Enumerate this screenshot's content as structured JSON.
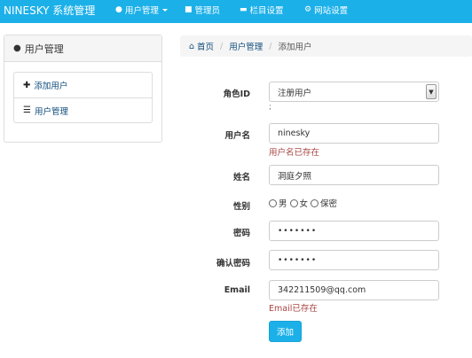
{
  "navbar": {
    "brand": "NINESKY 系统管理",
    "items": [
      {
        "label": "用户管理",
        "icon": "user-icon"
      },
      {
        "label": "管理员",
        "icon": "briefcase-icon"
      },
      {
        "label": "栏目设置",
        "icon": "folder-icon"
      },
      {
        "label": "网站设置",
        "icon": "gear-icon"
      }
    ],
    "background": "#1cb0e9"
  },
  "sidebar": {
    "title": "用户管理",
    "items": [
      {
        "label": "添加用户",
        "icon": "plus-icon"
      },
      {
        "label": "用户管理",
        "icon": "list-icon"
      }
    ]
  },
  "breadcrumb": {
    "home": "首页",
    "section": "用户管理",
    "current": "添加用户"
  },
  "form": {
    "role": {
      "label": "角色ID",
      "value": "注册用户",
      "note": ";"
    },
    "username": {
      "label": "用户名",
      "value": "ninesky",
      "error": "用户名已存在"
    },
    "name": {
      "label": "姓名",
      "value": "洞庭夕照"
    },
    "gender": {
      "label": "性别",
      "options": [
        "男",
        "女",
        "保密"
      ]
    },
    "password": {
      "label": "密码",
      "value": "•••••••"
    },
    "confirm": {
      "label": "确认密码",
      "value": "•••••••"
    },
    "email": {
      "label": "Email",
      "value": "342211509@qq.com",
      "error": "Email已存在"
    },
    "submit": "添加"
  },
  "colors": {
    "accent": "#1cb0e9",
    "error": "#a94442",
    "link": "#0d4b7a"
  }
}
